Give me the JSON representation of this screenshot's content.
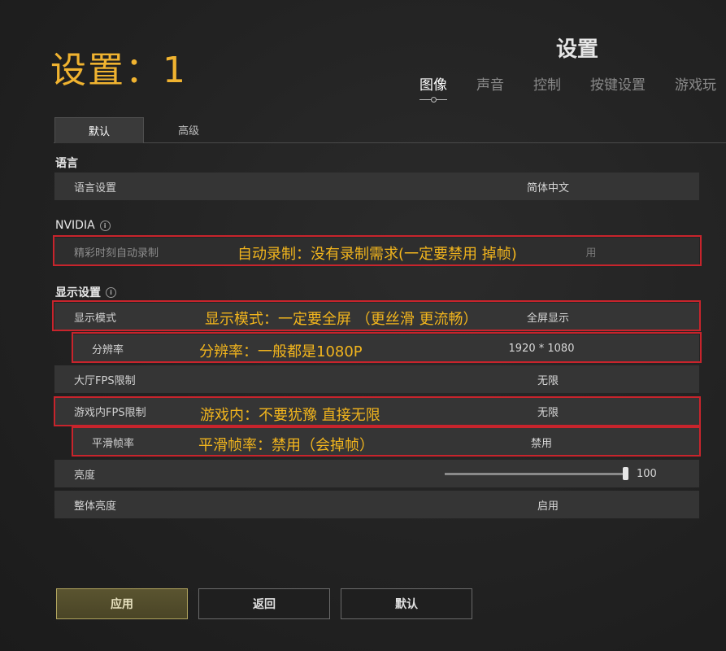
{
  "header": {
    "big_title": "设置：1",
    "screen_title": "设置",
    "tabs": [
      {
        "label": "图像",
        "active": true
      },
      {
        "label": "声音",
        "active": false
      },
      {
        "label": "控制",
        "active": false
      },
      {
        "label": "按键设置",
        "active": false
      },
      {
        "label": "游戏玩",
        "active": false
      }
    ]
  },
  "sub_tabs": [
    {
      "label": "默认",
      "active": true
    },
    {
      "label": "高级",
      "active": false
    }
  ],
  "sections": {
    "language": {
      "title": "语言"
    },
    "nvidia": {
      "title": "NVIDIA"
    },
    "display": {
      "title": "显示设置"
    }
  },
  "rows": {
    "language_setting": {
      "label": "语言设置",
      "value": "简体中文"
    },
    "auto_record": {
      "label": "精彩时刻自动录制",
      "value": "用"
    },
    "display_mode": {
      "label": "显示模式",
      "value": "全屏显示"
    },
    "resolution": {
      "label": "分辨率",
      "value": "1920 * 1080"
    },
    "lobby_fps": {
      "label": "大厅FPS限制",
      "value": "无限"
    },
    "ingame_fps": {
      "label": "游戏内FPS限制",
      "value": "无限"
    },
    "smooth_frame": {
      "label": "平滑帧率",
      "value": "禁用"
    },
    "brightness": {
      "label": "亮度",
      "value": "100",
      "level_percent": 100
    },
    "overall_brightness": {
      "label": "整体亮度",
      "value": "启用"
    }
  },
  "annotations": {
    "auto_record": "自动录制：没有录制需求(一定要禁用 掉帧)",
    "display_mode": "显示模式：一定要全屏 （更丝滑 更流畅）",
    "resolution": "分辨率：一般都是1080P",
    "ingame_fps": "游戏内：不要犹豫 直接无限",
    "smooth_frame": "平滑帧率：禁用（会掉帧）",
    "annotation_color": "#f2b51d",
    "box_color": "#c8242c"
  },
  "buttons": {
    "apply": "应用",
    "back": "返回",
    "default": "默认"
  },
  "colors": {
    "title_accent": "#f0b330",
    "primary_button_border": "#b0a35e"
  }
}
